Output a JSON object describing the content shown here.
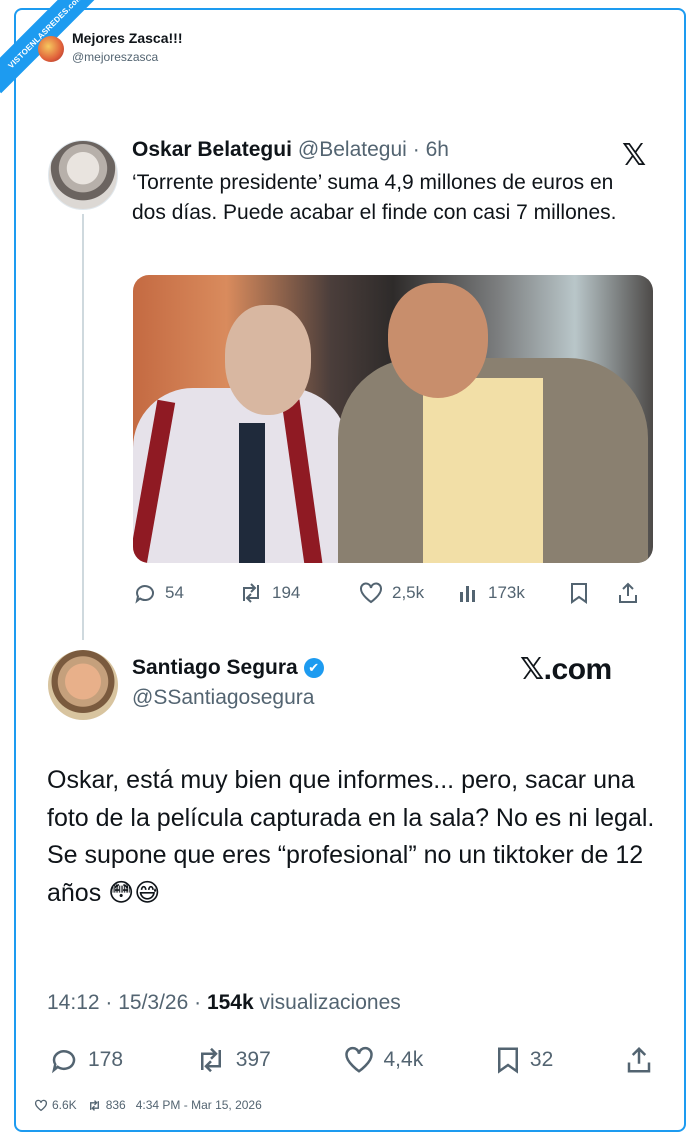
{
  "watermark": "VISTOENLASREDES.com",
  "source_account": {
    "name": "Mejores Zasca!!!",
    "handle": "@mejoreszasca"
  },
  "quoted_tweet": {
    "author": "Oskar Belategui",
    "handle": "@Belategui",
    "time": "· 6h",
    "platform_logo": "𝕏",
    "text": "‘Torrente presidente’ suma 4,9 millones de euros en dos días. Puede acabar el finde con casi 7 millones.",
    "image_alt": "Two men from the film",
    "replies": "54",
    "retweets": "194",
    "likes": "2,5k",
    "views": "173k"
  },
  "main_tweet": {
    "author": "Santiago Segura",
    "verified_icon": "✔",
    "handle": "@SSantiagosegura",
    "brand": "𝕏.com",
    "text_lines": [
      "Oskar, está muy bien que informes... pero, sacar una foto de la película capturada en la sala? No es ni legal.",
      "Se supone que eres “profesional” no un tiktoker de 12 años 😳😅"
    ],
    "timestamp": "14:12 · 15/3/26 ·",
    "views_count": "154k",
    "views_label": "visualizaciones",
    "replies": "178",
    "retweets": "397",
    "likes": "4,4k",
    "bookmarks": "32"
  },
  "footer": {
    "likes": "6.6K",
    "retweets": "836",
    "date": "4:34 PM - Mar 15, 2026"
  },
  "colors": {
    "accent": "#1d9bf0",
    "text": "#0f1419",
    "muted": "#536471"
  }
}
